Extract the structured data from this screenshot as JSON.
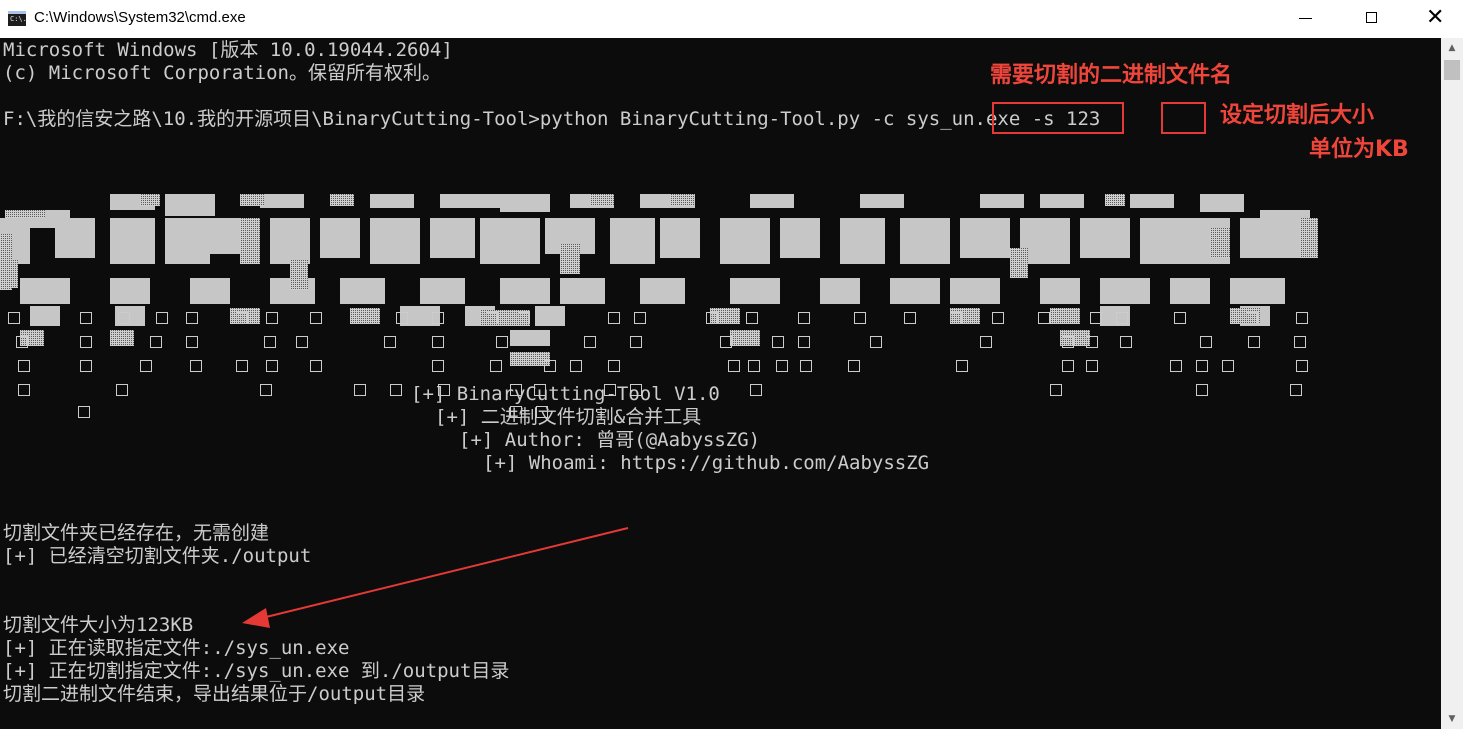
{
  "window": {
    "title": "C:\\Windows\\System32\\cmd.exe",
    "icon": "console-icon",
    "icon_text": "C:\\."
  },
  "console": {
    "header_lines": [
      "Microsoft Windows [版本 10.0.19044.2604]",
      "(c) Microsoft Corporation。保留所有权利。"
    ],
    "prompt_line": "F:\\我的信安之路\\10.我的开源项目\\BinaryCutting-Tool>python BinaryCutting-Tool.py -c sys_un.exe -s 123",
    "banner_art_text": "BinaryCutting",
    "banner_info": [
      "[+] BinaryCutting-Tool V1.0",
      "[+] 二进制文件切割&合并工具",
      "[+] Author: 曾哥(@AabyssZG)",
      "[+] Whoami: https://github.com/AabyssZG"
    ],
    "output_lines": [
      "切割文件夹已经存在，无需创建",
      "[+] 已经清空切割文件夹./output",
      "",
      "",
      "切割文件大小为123KB",
      "[+] 正在读取指定文件:./sys_un.exe",
      "[+] 正在切割指定文件:./sys_un.exe 到./output目录",
      "切割二进制文件结束，导出结果位于/output目录"
    ]
  },
  "annotations": {
    "binary_name_note": "需要切割的二进制文件名",
    "size_note_line1": "设定切割后大小",
    "size_note_line2": "单位为KB",
    "highlighted_arg_file": "sys_un.exe",
    "highlighted_arg_size": "123",
    "color": "#e53935"
  },
  "scrollbar": {
    "up_icon": "scroll-up-arrow-icon",
    "down_icon": "scroll-down-arrow-icon"
  }
}
